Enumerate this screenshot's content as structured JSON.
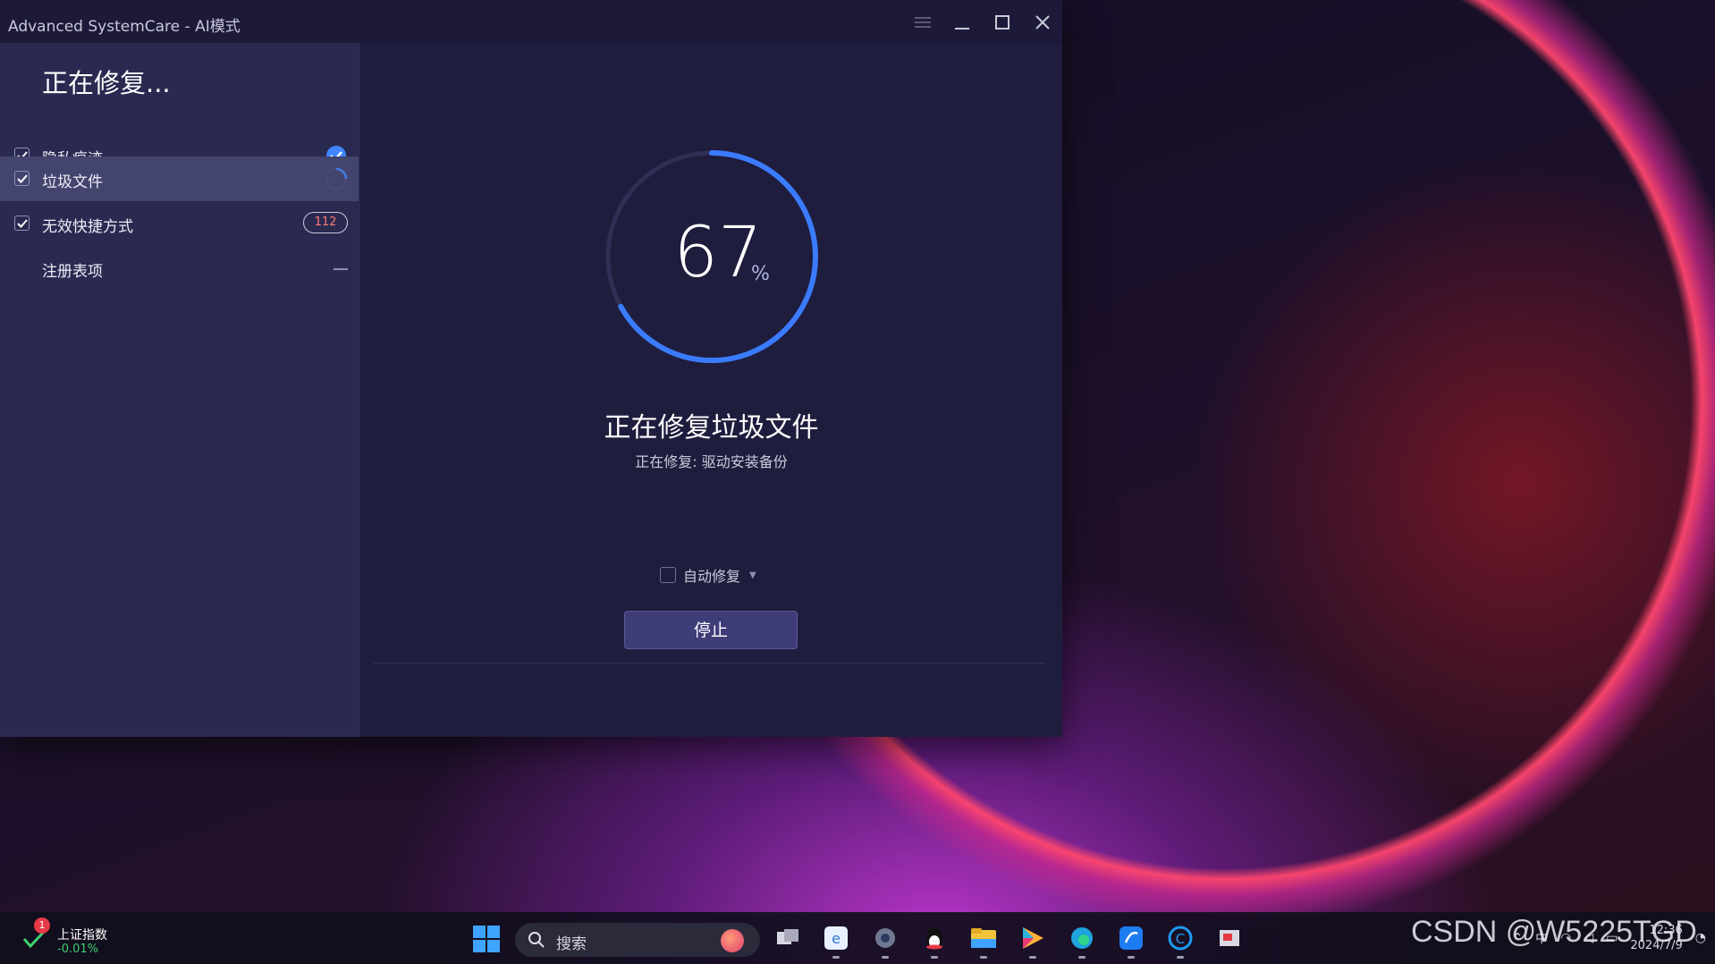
{
  "window": {
    "title": "Advanced SystemCare - AI模式"
  },
  "sidebar": {
    "heading": "正在修复...",
    "items": [
      {
        "label": "隐私痕迹",
        "checked": true,
        "status": "done-check-icon"
      },
      {
        "label": "垃圾文件",
        "checked": true,
        "status": "spinner-icon",
        "active": true
      },
      {
        "label": "无效快捷方式",
        "checked": true,
        "status_badge": "112"
      },
      {
        "label": "注册表项",
        "checked": false,
        "status": "dash-icon"
      }
    ]
  },
  "progress": {
    "value": "67",
    "unit": "%",
    "fraction": 0.67
  },
  "main": {
    "title": "正在修复垃圾文件",
    "subtitle": "正在修复: 驱动安装备份",
    "auto_fix_label": "自动修复",
    "stop_label": "停止"
  },
  "taskbar": {
    "stock_name": "上证指数",
    "stock_change": "-0.01%",
    "stock_badge": "1",
    "search_placeholder": "搜索",
    "apps": [
      "task-view-icon",
      "browser-icon",
      "settings-icon",
      "qq-icon",
      "file-explorer-icon",
      "media-player-icon",
      "edge-icon",
      "app-icon",
      "ccleaner-icon",
      "snipping-icon"
    ],
    "tray_ime": "中",
    "clock_time": "12:36",
    "clock_date": "2024/7/9"
  },
  "watermark": "CSDN @W5225TGD",
  "colors": {
    "accent": "#3a7bff",
    "window_bg": "#1f1d3d",
    "sidebar_bg": "#2a2a51",
    "active_item": "#44456f",
    "badge_text": "#ff7a7a"
  }
}
